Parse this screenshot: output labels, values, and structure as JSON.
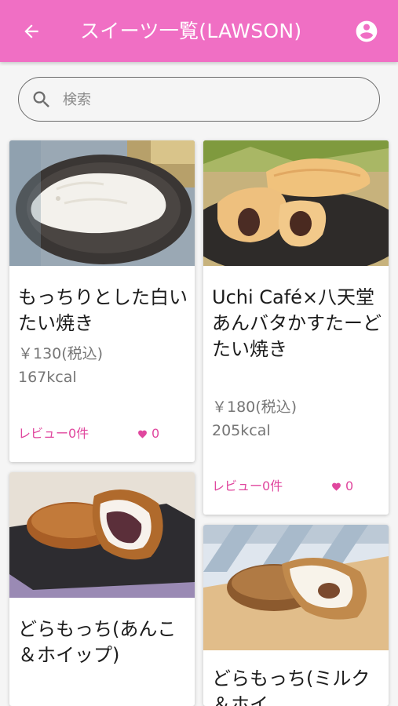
{
  "appbar": {
    "title": "スイーツ一覧(LAWSON)",
    "back_icon": "arrow-back-icon",
    "account_icon": "account-circle-icon",
    "color": "#f06fc4"
  },
  "search": {
    "placeholder": "検索",
    "value": "",
    "icon": "search-icon"
  },
  "accent_color": "#e0479e",
  "products": [
    {
      "name": "もっちりとした白いたい焼き",
      "price": "￥130(税込)",
      "kcal": "167kcal",
      "reviews": "レビュー0件",
      "likes": "0"
    },
    {
      "name": "Uchi Café×八天堂　あんバタかすたーどたい焼き",
      "price": "￥180(税込)",
      "kcal": "205kcal",
      "reviews": "レビュー0件",
      "likes": "0"
    },
    {
      "name": "どらもっち(あんこ＆ホイップ)"
    },
    {
      "name": "どらもっち(ミルク＆ホイ"
    }
  ]
}
